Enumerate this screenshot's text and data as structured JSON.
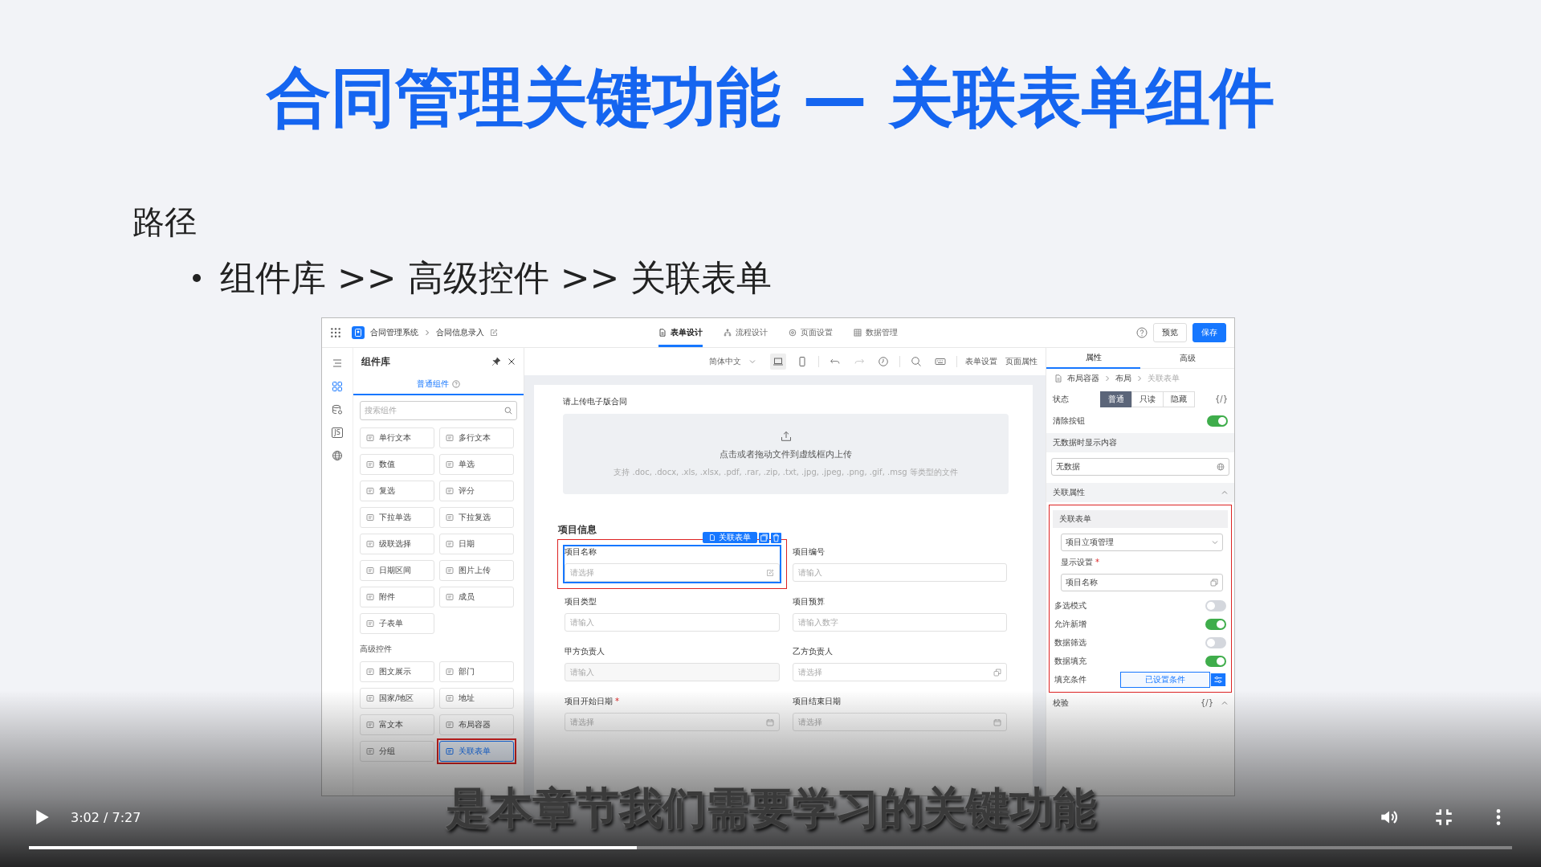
{
  "slide": {
    "title": "合同管理关键功能 — 关联表单组件",
    "heading": "路径",
    "bullets": [
      "组件库 >> 高级控件 >> 关联表单"
    ]
  },
  "app": {
    "breadcrumb": [
      "合同管理系统",
      "合同信息录入"
    ],
    "tabs": [
      {
        "label": "表单设计",
        "selected": true
      },
      {
        "label": "流程设计",
        "selected": false
      },
      {
        "label": "页面设置",
        "selected": false
      },
      {
        "label": "数据管理",
        "selected": false
      }
    ],
    "preview": "预览",
    "save": "保存",
    "rail": [
      {
        "kind": "outline",
        "selected": false
      },
      {
        "kind": "components",
        "selected": true
      },
      {
        "kind": "data",
        "selected": false
      },
      {
        "kind": "js",
        "label": "JS",
        "selected": false
      },
      {
        "kind": "globe",
        "selected": false
      }
    ],
    "library": {
      "title": "组件库",
      "tab": "普通组件",
      "search_placeholder": "搜索组件",
      "basic": [
        {
          "label": "单行文本",
          "selected": false,
          "highlighted": false
        },
        {
          "label": "多行文本",
          "selected": false,
          "highlighted": false
        },
        {
          "label": "数值",
          "selected": false,
          "highlighted": false
        },
        {
          "label": "单选",
          "selected": false,
          "highlighted": false
        },
        {
          "label": "复选",
          "selected": false,
          "highlighted": false
        },
        {
          "label": "评分",
          "selected": false,
          "highlighted": false
        },
        {
          "label": "下拉单选",
          "selected": false,
          "highlighted": false
        },
        {
          "label": "下拉复选",
          "selected": false,
          "highlighted": false
        },
        {
          "label": "级联选择",
          "selected": false,
          "highlighted": false
        },
        {
          "label": "日期",
          "selected": false,
          "highlighted": false
        },
        {
          "label": "日期区间",
          "selected": false,
          "highlighted": false
        },
        {
          "label": "图片上传",
          "selected": false,
          "highlighted": false
        },
        {
          "label": "附件",
          "selected": false,
          "highlighted": false
        },
        {
          "label": "成员",
          "selected": false,
          "highlighted": false
        },
        {
          "label": "子表单",
          "selected": false,
          "highlighted": false
        }
      ],
      "advanced_heading": "高级控件",
      "advanced": [
        {
          "label": "图文展示",
          "selected": false,
          "highlighted": false
        },
        {
          "label": "部门",
          "selected": false,
          "highlighted": false
        },
        {
          "label": "国家/地区",
          "selected": false,
          "highlighted": false
        },
        {
          "label": "地址",
          "selected": false,
          "highlighted": false
        },
        {
          "label": "富文本",
          "selected": false,
          "highlighted": false
        },
        {
          "label": "布局容器",
          "selected": false,
          "highlighted": false
        },
        {
          "label": "分组",
          "selected": false,
          "highlighted": false
        },
        {
          "label": "关联表单",
          "selected": true,
          "highlighted": true
        }
      ]
    },
    "toolbar": {
      "language": "简体中文",
      "links": [
        "表单设置",
        "页面属性"
      ]
    },
    "form": {
      "upload": {
        "label": "请上传电子版合同",
        "hint": "点击或者拖动文件到虚线框内上传",
        "formats": "支持 .doc, .docx, .xls, .xlsx, .pdf, .rar, .zip, .txt, .jpg, .jpeg, .png, .gif, .msg 等类型的文件"
      },
      "section": "项目信息",
      "badge": "关联表单",
      "fields": [
        {
          "label": "项目名称",
          "placeholder": "请选择",
          "kind": "picker",
          "selected": true,
          "highlighted": true
        },
        {
          "label": "项目编号",
          "placeholder": "请输入",
          "kind": "text",
          "selected": false,
          "highlighted": false
        },
        {
          "label": "项目类型",
          "placeholder": "请输入",
          "kind": "text",
          "selected": false,
          "highlighted": false
        },
        {
          "label": "项目预算",
          "placeholder": "请输入数字",
          "kind": "text",
          "selected": false,
          "highlighted": false
        },
        {
          "label": "甲方负责人",
          "placeholder": "请输入",
          "kind": "text",
          "selected": false,
          "highlighted": false
        },
        {
          "label": "乙方负责人",
          "placeholder": "请选择",
          "kind": "member",
          "selected": false,
          "highlighted": false
        },
        {
          "label": "项目开始日期",
          "mark": "*",
          "placeholder": "请选择",
          "kind": "date",
          "selected": false,
          "highlighted": false
        },
        {
          "label": "项目结束日期",
          "placeholder": "请选择",
          "kind": "date",
          "selected": false,
          "highlighted": false
        }
      ]
    },
    "properties": {
      "tabs": [
        {
          "label": "属性",
          "selected": true
        },
        {
          "label": "高级",
          "selected": false
        }
      ],
      "path": [
        "布局容器",
        "布局",
        "关联表单"
      ],
      "state_label": "状态",
      "states": [
        {
          "label": "普通",
          "selected": true
        },
        {
          "label": "只读",
          "selected": false
        },
        {
          "label": "隐藏",
          "selected": false
        }
      ],
      "expr": "{/}",
      "clear": {
        "label": "清除按钮",
        "on": true
      },
      "empty_heading": "无数据时显示内容",
      "empty_value": "无数据",
      "assoc_heading": "关联属性",
      "assoc": {
        "highlighted": true,
        "heading": "关联表单",
        "form_value": "项目立项管理",
        "display_label": "显示设置",
        "display_mark": "*",
        "display_value": "项目名称",
        "switches": [
          {
            "label": "多选模式",
            "on": false
          },
          {
            "label": "允许新增",
            "on": true
          },
          {
            "label": "数据筛选",
            "on": false
          },
          {
            "label": "数据填充",
            "on": true
          }
        ],
        "fill_label": "填充条件",
        "fill_value": "已设置条件"
      },
      "validation": "校验",
      "validation_expr": "{/}"
    }
  },
  "player": {
    "subtitle": "是本章节我们需要学习的关键功能",
    "time": "3:02 / 7:27",
    "level": 0.41
  }
}
